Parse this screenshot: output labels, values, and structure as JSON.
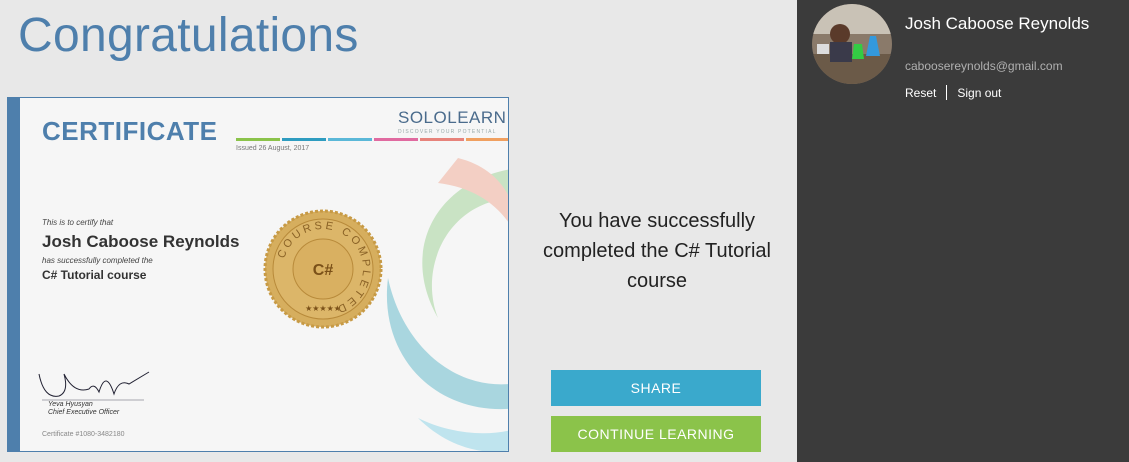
{
  "page": {
    "title": "Congratulations"
  },
  "certificate": {
    "heading": "CERTIFICATE",
    "issued": "Issued 26 August, 2017",
    "logo": {
      "text_solo": "SOLO",
      "text_learn": "LEARN",
      "tagline": "DISCOVER YOUR POTENTIAL"
    },
    "intro": "This is to certify that",
    "recipient": "Josh Caboose Reynolds",
    "completed_text": "has successfully completed the",
    "course": "C# Tutorial course",
    "seal": {
      "ring_text": "COURSE COMPLETED",
      "center": "C#",
      "stars": "★★★★★"
    },
    "signer_name": "Yeva Hyusyan",
    "signer_title": "Chief Executive Officer",
    "number": "Certificate #1080-3482180",
    "colors": [
      "#8bc34a",
      "#2e9cc0",
      "#5bb8d8",
      "#e06aa0",
      "#e7837b",
      "#f0a060"
    ]
  },
  "message": "You have successfully completed the C# Tutorial course",
  "actions": {
    "share_label": "SHARE",
    "continue_label": "CONTINUE LEARNING"
  },
  "user": {
    "name": "Josh Caboose Reynolds",
    "email": "caboosereynolds@gmail.com",
    "reset_label": "Reset",
    "signout_label": "Sign out"
  },
  "colors": {
    "accent": "#4e7fac",
    "share": "#3aa9cc",
    "continue": "#8bc34a",
    "sidebar": "#3b3b3b",
    "seal_gold": "#d6ae5e"
  }
}
